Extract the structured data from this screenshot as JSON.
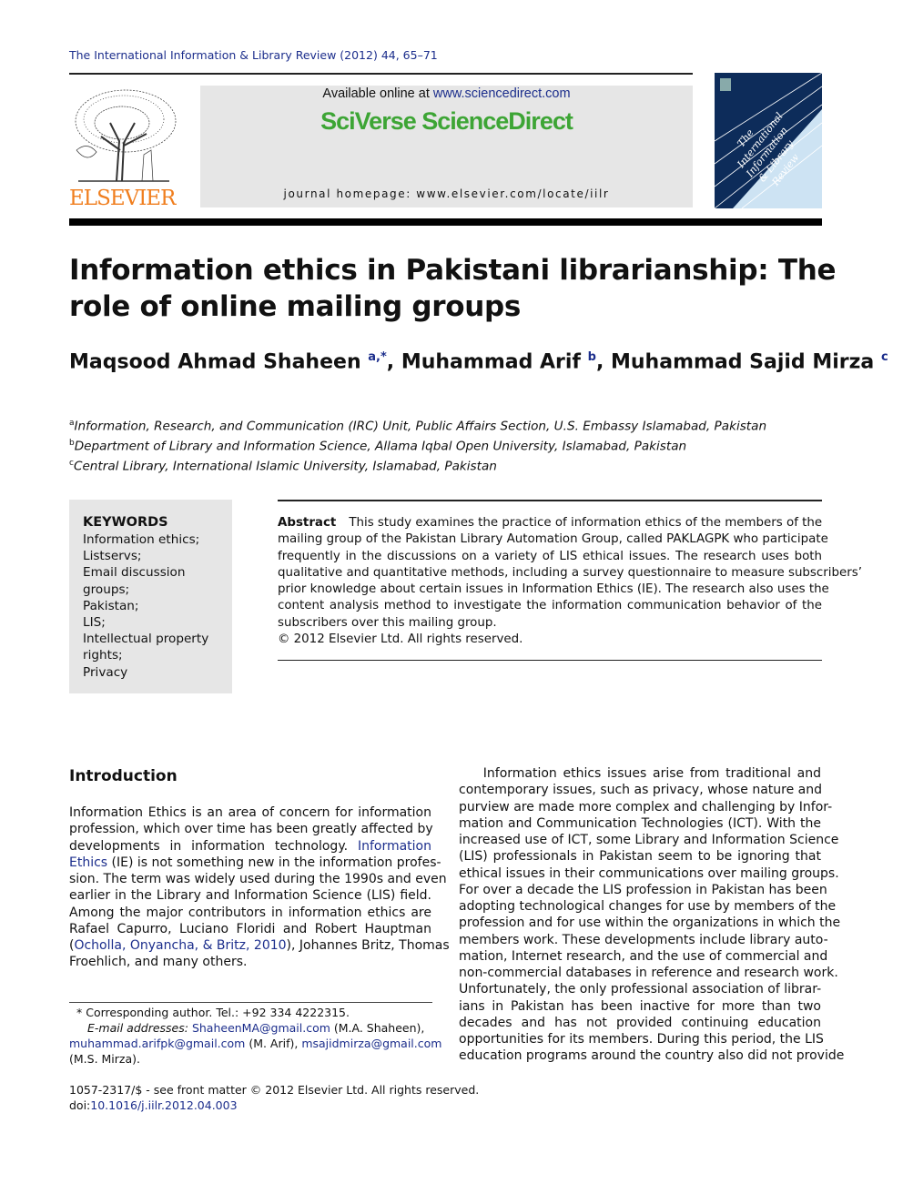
{
  "running_head": "The International Information & Library Review (2012) 44, 65–71",
  "logo": {
    "publisher": "ELSEVIER"
  },
  "banner": {
    "available_prefix": "Available online at ",
    "available_link": "www.sciencedirect.com",
    "brand": "SciVerse ScienceDirect",
    "homepage": "journal homepage: www.elsevier.com/locate/iilr"
  },
  "cover": {
    "title_lines": [
      "The",
      "International",
      "Information",
      "& Library",
      "Review"
    ]
  },
  "title_lines": [
    "Information ethics in Pakistani librarianship: The",
    "role of online mailing groups"
  ],
  "authors": [
    {
      "name": "Maqsood Ahmad Shaheen",
      "sup": "a,*"
    },
    {
      "name": "Muhammad Arif",
      "sup": "b"
    },
    {
      "name": "Muhammad Sajid Mirza",
      "sup": "c"
    }
  ],
  "author_sep": ", ",
  "affiliations": [
    {
      "sup": "a",
      "text": "Information, Research, and Communication (IRC) Unit, Public Affairs Section, U.S. Embassy Islamabad, Pakistan"
    },
    {
      "sup": "b",
      "text": "Department of Library and Information Science, Allama Iqbal Open University, Islamabad, Pakistan"
    },
    {
      "sup": "c",
      "text": "Central Library, International Islamic University, Islamabad, Pakistan"
    }
  ],
  "keywords": {
    "heading": "KEYWORDS",
    "lines": [
      "Information ethics;",
      "Listservs;",
      "Email discussion",
      "groups;",
      "Pakistan;",
      "LIS;",
      "Intellectual property",
      "rights;",
      "Privacy"
    ]
  },
  "abstract": {
    "label": "Abstract",
    "lines": [
      "This study examines the practice of information ethics of the members of the",
      "mailing group of the Pakistan Library Automation Group, called PAKLAGPK who participate",
      "frequently in the discussions on a variety of LIS ethical issues. The research uses both",
      "qualitative and quantitative methods, including a survey questionnaire to measure subscribers’",
      "prior knowledge about certain issues in Information Ethics (IE). The research also uses the",
      "content analysis method to investigate the information communication behavior of the",
      "subscribers over this mailing group."
    ],
    "copyright": "© 2012 Elsevier Ltd. All rights reserved."
  },
  "introduction": {
    "heading": "Introduction",
    "col1": [
      [
        {
          "t": "Information Ethics is an area of concern for information"
        }
      ],
      [
        {
          "t": "profession, which over time has been greatly affected by"
        }
      ],
      [
        {
          "t": "developments in information technology. "
        },
        {
          "t": "Information",
          "link": true
        }
      ],
      [
        {
          "t": "Ethics",
          "link": true
        },
        {
          "t": " (IE) is not something new in the information profes-"
        }
      ],
      [
        {
          "t": "sion. The term was widely used during the 1990s and even"
        }
      ],
      [
        {
          "t": "earlier in the Library and Information Science (LIS) field."
        }
      ],
      [
        {
          "t": "Among the major contributors in information ethics are"
        }
      ],
      [
        {
          "t": "Rafael Capurro, Luciano Floridi and Robert Hauptman"
        }
      ],
      [
        {
          "t": "("
        },
        {
          "t": "Ocholla, Onyancha, & Britz, 2010",
          "link": true
        },
        {
          "t": "), Johannes Britz, Thomas"
        }
      ],
      [
        {
          "t": "Froehlich, and many others."
        }
      ]
    ],
    "col2": [
      [
        {
          "t": "    Information ethics issues arise from traditional and"
        }
      ],
      [
        {
          "t": "contemporary issues, such as privacy, whose nature and"
        }
      ],
      [
        {
          "t": "purview are made more complex and challenging by Infor-"
        }
      ],
      [
        {
          "t": "mation and Communication Technologies (ICT). With the"
        }
      ],
      [
        {
          "t": "increased use of ICT, some Library and Information Science"
        }
      ],
      [
        {
          "t": "(LIS) professionals in Pakistan seem to be ignoring that"
        }
      ],
      [
        {
          "t": "ethical issues in their communications over mailing groups."
        }
      ],
      [
        {
          "t": "For over a decade the LIS profession in Pakistan has been"
        }
      ],
      [
        {
          "t": "adopting technological changes for use by members of the"
        }
      ],
      [
        {
          "t": "profession and for use within the organizations in which the"
        }
      ],
      [
        {
          "t": "members work. These developments include library auto-"
        }
      ],
      [
        {
          "t": "mation, Internet research, and the use of commercial and"
        }
      ],
      [
        {
          "t": "non-commercial databases in reference and research work."
        }
      ],
      [
        {
          "t": "Unfortunately, the only professional association of librar-"
        }
      ],
      [
        {
          "t": "ians in Pakistan has been inactive for more than two"
        }
      ],
      [
        {
          "t": "decades and has not provided continuing education"
        }
      ],
      [
        {
          "t": "opportunities for its members. During this period, the LIS"
        }
      ],
      [
        {
          "t": "education programs around the country also did not provide"
        }
      ]
    ]
  },
  "footnote": {
    "lines": [
      [
        {
          "t": "* Corresponding author. Tel.: +92 334 4222315."
        }
      ],
      [
        {
          "t": "E-mail addresses: ",
          "italic": true
        },
        {
          "t": "ShaheenMA@gmail.com",
          "link": true
        },
        {
          "t": " (M.A. Shaheen),"
        }
      ],
      [
        {
          "t": "muhammad.arifpk@gmail.com",
          "link": true
        },
        {
          "t": " (M. Arif), "
        },
        {
          "t": "msajidmirza@gmail.com",
          "link": true
        }
      ],
      [
        {
          "t": "(M.S. Mirza)."
        }
      ]
    ]
  },
  "issn": "1057-2317/$ - see front matter © 2012 Elsevier Ltd. All rights reserved.",
  "doi_prefix": "doi:",
  "doi": "10.1016/j.iilr.2012.04.003",
  "colors": {
    "link": "#1c2e8c",
    "brand_green": "#3da535",
    "elsevier_orange": "#f07e1e",
    "cover_navy": "#0d2c5a",
    "panel_gray": "#e6e6e6"
  }
}
